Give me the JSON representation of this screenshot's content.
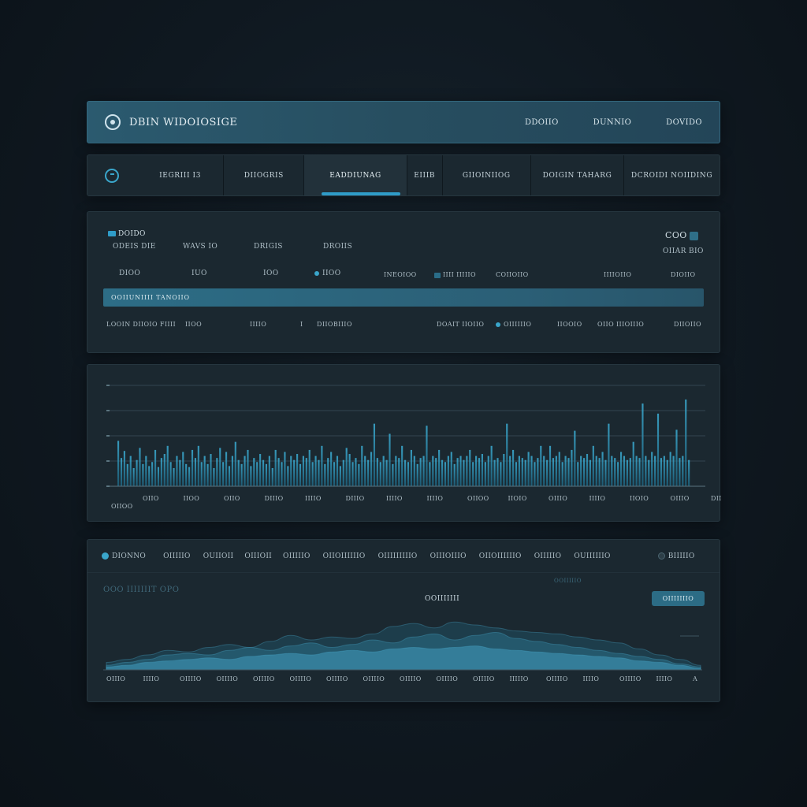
{
  "header": {
    "title": "DBIN WIDOIOSIGE",
    "links": [
      "DDOIIO",
      "DUNNIO",
      "DOVIDO"
    ]
  },
  "tabs": [
    {
      "label": "IEGRIII I3",
      "active": false
    },
    {
      "label": "DIIOGRIS",
      "active": false
    },
    {
      "label": "EADDIUNAG",
      "active": true
    },
    {
      "label": "EIIIB",
      "active": false
    },
    {
      "label": "GIIOINIIOG",
      "active": false
    },
    {
      "label": "DOIGIN TAHARG",
      "active": false
    },
    {
      "label": "DCROIDI NOIIDING",
      "active": false
    }
  ],
  "summary": {
    "chip_label": "DOIDO",
    "row1": [
      "ODEIS DIE",
      "WAVS IO",
      "DRIGIS",
      "DROIIS"
    ],
    "top_right_value": "COO",
    "top_right_sub": "OIIAR BIO",
    "row2": [
      "DIOO",
      "IUO",
      "IOO",
      "IIOO",
      "INEOIOO",
      "IIII IIIIIO",
      "COIIOIIO",
      "IIIIOIIO",
      "DIOIIO"
    ],
    "progress_label": "OOIIUNIIII TANOIIO",
    "progress_value": 1.0,
    "row3": [
      "LOOIN DIIOIO FIIII",
      "IIOO",
      "IIIIO",
      "I",
      "DIIOBIIIO",
      "DOAIT IIOIIO",
      "OIIIIIIO",
      "IIOOIO",
      "OIIO IIIOIIIO",
      "DIIOIIO"
    ]
  },
  "bar_chart": {
    "x_labels": [
      "OIIO",
      "IIOO",
      "OIIO",
      "DIIIO",
      "IIIIO",
      "DIIIO",
      "IIIIO",
      "IIIIO",
      "OIIOO",
      "IIOIO",
      "OIIIO",
      "IIIIO",
      "IIOIO",
      "OIIIO",
      "DIIIO"
    ],
    "corner_label": "OIIOO"
  },
  "area_chart": {
    "legend": [
      "DIONNO",
      "OIIIIIO",
      "OUIIOII",
      "OIIIOII",
      "OIIIIIO",
      "OIIOIIIIIIO",
      "OIIIIIIIIIO",
      "OIIIOIIIO",
      "OIIOIIIIIIO",
      "OIIIIIO",
      "OUIIIIIIO",
      "BIIIIIO"
    ],
    "caption": "OOO IIIIIIIT OPO",
    "center_label": "OOIIIIIII",
    "button_label": "OIIIIIIIO",
    "note": "OOIIIIIO",
    "x_labels": [
      "OIIIO",
      "IIIIO",
      "OIIIIO",
      "OIIIIO",
      "OIIIIO",
      "OIIIIO",
      "OIIIIO",
      "OIIIIO",
      "OIIIIO",
      "OIIIIO",
      "OIIIIO",
      "IIIIIO",
      "OIIIIO",
      "IIIIO",
      "OIIIIO",
      "IIIIO",
      "A"
    ]
  },
  "chart_data": [
    {
      "type": "bar",
      "values": [
        0.45,
        0.28,
        0.35,
        0.22,
        0.3,
        0.18,
        0.26,
        0.38,
        0.22,
        0.3,
        0.2,
        0.24,
        0.36,
        0.19,
        0.28,
        0.32,
        0.4,
        0.24,
        0.18,
        0.3,
        0.26,
        0.34,
        0.22,
        0.19,
        0.36,
        0.28,
        0.4,
        0.24,
        0.3,
        0.22,
        0.32,
        0.18,
        0.28,
        0.38,
        0.24,
        0.34,
        0.2,
        0.3,
        0.44,
        0.26,
        0.22,
        0.3,
        0.36,
        0.2,
        0.28,
        0.24,
        0.32,
        0.26,
        0.22,
        0.3,
        0.18,
        0.36,
        0.28,
        0.24,
        0.34,
        0.2,
        0.3,
        0.26,
        0.32,
        0.22,
        0.3,
        0.28,
        0.36,
        0.24,
        0.3,
        0.26,
        0.4,
        0.22,
        0.28,
        0.34,
        0.24,
        0.3,
        0.2,
        0.26,
        0.38,
        0.32,
        0.24,
        0.28,
        0.22,
        0.4,
        0.3,
        0.26,
        0.34,
        0.62,
        0.28,
        0.24,
        0.3,
        0.26,
        0.52,
        0.22,
        0.3,
        0.28,
        0.4,
        0.26,
        0.24,
        0.36,
        0.3,
        0.22,
        0.28,
        0.3,
        0.6,
        0.24,
        0.3,
        0.28,
        0.36,
        0.26,
        0.24,
        0.3,
        0.34,
        0.22,
        0.28,
        0.3,
        0.26,
        0.3,
        0.36,
        0.24,
        0.3,
        0.28,
        0.32,
        0.24,
        0.3,
        0.4,
        0.26,
        0.28,
        0.24,
        0.32,
        0.62,
        0.3,
        0.36,
        0.24,
        0.3,
        0.28,
        0.26,
        0.34,
        0.3,
        0.24,
        0.28,
        0.4,
        0.3,
        0.26,
        0.4,
        0.28,
        0.3,
        0.34,
        0.24,
        0.3,
        0.28,
        0.36,
        0.55,
        0.24,
        0.3,
        0.28,
        0.32,
        0.26,
        0.4,
        0.3,
        0.28,
        0.34,
        0.26,
        0.62,
        0.3,
        0.28,
        0.24,
        0.34,
        0.3,
        0.26,
        0.28,
        0.44,
        0.3,
        0.28,
        0.82,
        0.3,
        0.26,
        0.34,
        0.3,
        0.72,
        0.28,
        0.3,
        0.26,
        0.34,
        0.3,
        0.56,
        0.28,
        0.3,
        0.86,
        0.26
      ],
      "ylim": [
        0,
        1
      ],
      "grid": true
    },
    {
      "type": "area",
      "series": [
        {
          "values": [
            0.1,
            0.14,
            0.2,
            0.26,
            0.24,
            0.3,
            0.34,
            0.3,
            0.38,
            0.46,
            0.4,
            0.44,
            0.42,
            0.48,
            0.58,
            0.62,
            0.56,
            0.64,
            0.6,
            0.56,
            0.52,
            0.5,
            0.48,
            0.44,
            0.4,
            0.36,
            0.28,
            0.2,
            0.14,
            0.06
          ]
        },
        {
          "values": [
            0.06,
            0.1,
            0.14,
            0.2,
            0.22,
            0.2,
            0.26,
            0.3,
            0.26,
            0.32,
            0.36,
            0.3,
            0.34,
            0.4,
            0.36,
            0.44,
            0.48,
            0.4,
            0.46,
            0.5,
            0.42,
            0.38,
            0.34,
            0.3,
            0.26,
            0.22,
            0.18,
            0.14,
            0.08,
            0.04
          ]
        },
        {
          "values": [
            0.04,
            0.06,
            0.1,
            0.12,
            0.14,
            0.16,
            0.14,
            0.18,
            0.2,
            0.22,
            0.2,
            0.24,
            0.26,
            0.24,
            0.28,
            0.3,
            0.28,
            0.3,
            0.32,
            0.28,
            0.26,
            0.24,
            0.22,
            0.2,
            0.18,
            0.16,
            0.12,
            0.1,
            0.06,
            0.02
          ]
        }
      ],
      "ylim": [
        0,
        1
      ]
    }
  ]
}
